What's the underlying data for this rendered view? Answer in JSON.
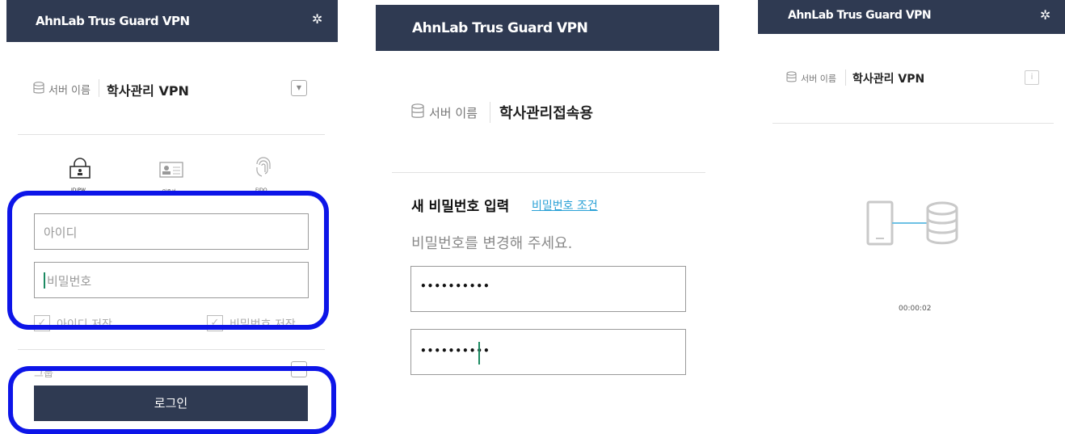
{
  "brand": "AhnLab Trus Guard VPN",
  "colors": {
    "titlebar": "#2f3a52",
    "highlight": "#0d15e8",
    "link": "#2aa1d6"
  },
  "panel1": {
    "server_label": "서버 이름",
    "server_name": "학사관리 VPN",
    "auth_tabs": [
      "ID/PW",
      "인증서",
      "FIDO"
    ],
    "id_placeholder": "아이디",
    "pw_placeholder": "비밀번호",
    "save_id_label": "아이디 저장",
    "save_pw_label": "비밀번호 저장",
    "group_label": "그룹",
    "login_button": "로그인"
  },
  "panel2": {
    "server_label": "서버 이름",
    "server_name": "학사관리접속용",
    "heading": "새 비밀번호 입력",
    "conditions_link": "비밀번호 조건",
    "instruction": "비밀번호를 변경해 주세요.",
    "new_password_mask": "••••••••••",
    "confirm_password_mask": "••••••••••"
  },
  "panel3": {
    "server_label": "서버 이름",
    "server_name": "학사관리 VPN",
    "elapsed": "00:00:02"
  }
}
